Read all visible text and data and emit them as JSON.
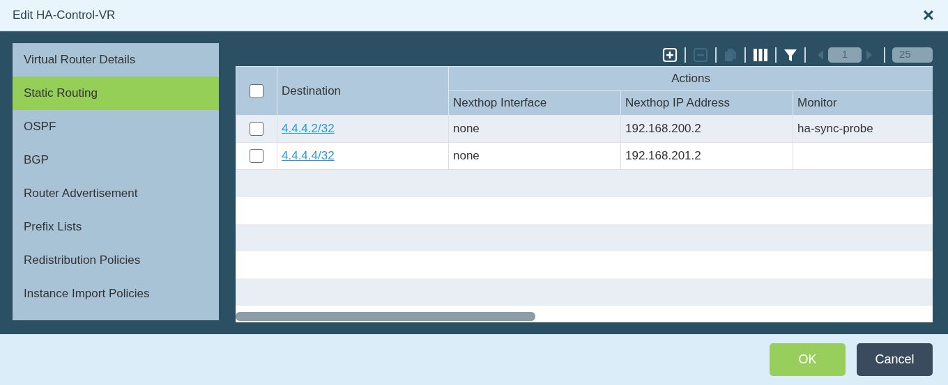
{
  "window": {
    "title": "Edit HA-Control-VR",
    "close": "×"
  },
  "sidebar": {
    "items": [
      {
        "label": "Virtual Router Details",
        "selected": false
      },
      {
        "label": "Static Routing",
        "selected": true
      },
      {
        "label": "OSPF",
        "selected": false
      },
      {
        "label": "BGP",
        "selected": false
      },
      {
        "label": "Router Advertisement",
        "selected": false
      },
      {
        "label": "Prefix Lists",
        "selected": false
      },
      {
        "label": "Redistribution Policies",
        "selected": false
      },
      {
        "label": "Instance Import Policies",
        "selected": false
      }
    ]
  },
  "toolbar": {
    "buttons": [
      {
        "kind": "add",
        "disabled": false
      },
      {
        "kind": "delete",
        "disabled": true
      },
      {
        "kind": "clone",
        "disabled": true
      },
      {
        "kind": "columns",
        "disabled": false
      },
      {
        "kind": "filter",
        "disabled": false
      }
    ],
    "pager": {
      "prev_disabled": true,
      "page": "1",
      "next_disabled": true,
      "page_size": "25"
    }
  },
  "table": {
    "select_all_checked": false,
    "columns": {
      "destination": "Destination",
      "group": "Actions",
      "sub": [
        "Nexthop Interface",
        "Nexthop IP Address",
        "Monitor"
      ]
    },
    "rows": [
      {
        "checked": false,
        "destination": "4.4.4.2/32",
        "cells": [
          "none",
          "192.168.200.2",
          "ha-sync-probe"
        ]
      },
      {
        "checked": false,
        "destination": "4.4.4.4/32",
        "cells": [
          "none",
          "192.168.201.2",
          ""
        ]
      }
    ]
  },
  "buttons": [
    {
      "kind": "primary",
      "label": "OK"
    },
    {
      "kind": "secondary",
      "label": "Cancel"
    }
  ]
}
